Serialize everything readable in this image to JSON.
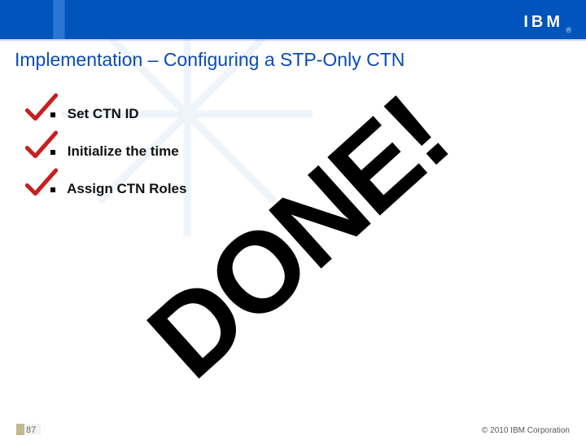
{
  "header": {
    "logo_text": "IBM",
    "logo_registered": "®"
  },
  "title": "Implementation – Configuring a STP-Only CTN",
  "bullets": {
    "items": [
      {
        "label": "Set CTN ID",
        "checked": true
      },
      {
        "label": "Initialize the time",
        "checked": true
      },
      {
        "label": "Assign CTN Roles",
        "checked": true
      }
    ]
  },
  "stamp": "DONE!",
  "footer": {
    "slide_number": "87",
    "copyright": "© 2010 IBM Corporation"
  },
  "colors": {
    "brand_blue": "#0054bb",
    "title_blue": "#0b4bb4",
    "check_red": "#c71f1f"
  }
}
